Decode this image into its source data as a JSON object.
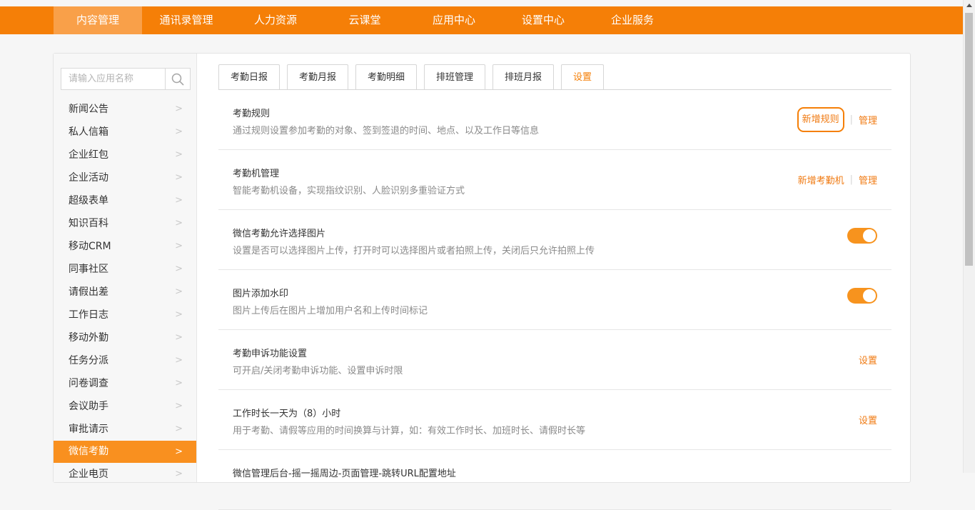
{
  "topnav": {
    "items": [
      {
        "label": "内容管理",
        "active": true
      },
      {
        "label": "通讯录管理",
        "active": false
      },
      {
        "label": "人力资源",
        "active": false
      },
      {
        "label": "云课堂",
        "active": false
      },
      {
        "label": "应用中心",
        "active": false
      },
      {
        "label": "设置中心",
        "active": false
      },
      {
        "label": "企业服务",
        "active": false
      }
    ]
  },
  "sidebar": {
    "search_placeholder": "请输入应用名称",
    "items": [
      {
        "label": "新闻公告",
        "chevron": ">"
      },
      {
        "label": "私人信箱",
        "chevron": ">"
      },
      {
        "label": "企业红包",
        "chevron": ">"
      },
      {
        "label": "企业活动",
        "chevron": ">"
      },
      {
        "label": "超级表单",
        "chevron": ">"
      },
      {
        "label": "知识百科",
        "chevron": ">"
      },
      {
        "label": "移动CRM",
        "chevron": ">"
      },
      {
        "label": "同事社区",
        "chevron": ">"
      },
      {
        "label": "请假出差",
        "chevron": ">"
      },
      {
        "label": "工作日志",
        "chevron": ">"
      },
      {
        "label": "移动外勤",
        "chevron": ">"
      },
      {
        "label": "任务分派",
        "chevron": ">"
      },
      {
        "label": "问卷调查",
        "chevron": ">"
      },
      {
        "label": "会议助手",
        "chevron": ">"
      },
      {
        "label": "审批请示",
        "chevron": ">"
      },
      {
        "label": "微信考勤",
        "chevron": ">",
        "active": true
      },
      {
        "label": "企业电页",
        "chevron": ">"
      }
    ]
  },
  "tabs": [
    {
      "label": "考勤日报"
    },
    {
      "label": "考勤月报"
    },
    {
      "label": "考勤明细"
    },
    {
      "label": "排班管理"
    },
    {
      "label": "排班月报"
    },
    {
      "label": "设置",
      "selected": true
    }
  ],
  "settings": {
    "rule": {
      "title": "考勤规则",
      "desc": "通过规则设置参加考勤的对象、签到签退的时间、地点、以及工作日等信息",
      "add_label": "新增规则",
      "sep": "|",
      "manage_label": "管理"
    },
    "machine": {
      "title": "考勤机管理",
      "desc": "智能考勤机设备，实现指纹识别、人脸识别多重验证方式",
      "add_label": "新增考勤机",
      "sep": "|",
      "manage_label": "管理"
    },
    "wechat_photo": {
      "title": "微信考勤允许选择图片",
      "desc": "设置是否可以选择图片上传，打开时可以选择图片或者拍照上传，关闭后只允许拍照上传",
      "enabled": true
    },
    "watermark": {
      "title": "图片添加水印",
      "desc": "图片上传后在图片上增加用户名和上传时间标记",
      "enabled": true
    },
    "appeal": {
      "title": "考勤申诉功能设置",
      "desc": "可开启/关闭考勤申诉功能、设置申诉时限",
      "action_label": "设置"
    },
    "work_hours": {
      "title": "工作时长一天为（8）小时",
      "desc": "用于考勤、请假等应用的时间换算与计算，如：有效工作时长、加班时长、请假时长等",
      "action_label": "设置"
    },
    "shake": {
      "title": "微信管理后台-摇一摇周边-页面管理-跳转URL配置地址"
    }
  },
  "colors": {
    "brand": "#f57f07",
    "nav_active": "#f9a049",
    "sidebar_active": "#f9901f",
    "link": "#f07a12",
    "toggle_on": "#f7931e"
  }
}
